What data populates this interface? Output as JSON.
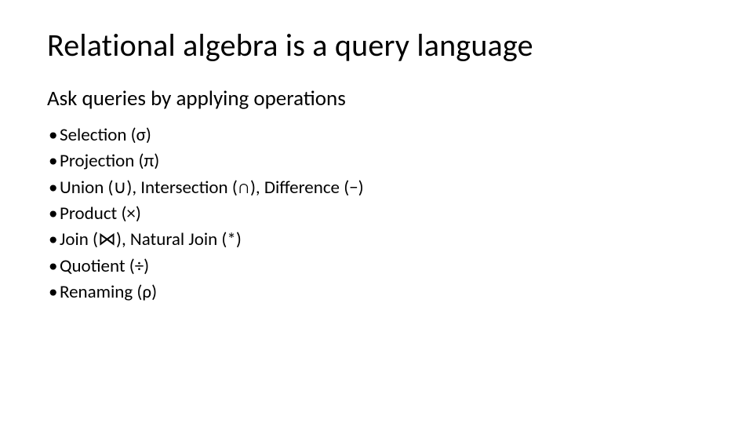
{
  "slide": {
    "title": "Relational algebra is a query language",
    "subheading": "Ask queries by applying operations",
    "bullets": [
      "Selection (σ)",
      "Projection (π)",
      "Union (∪), Intersection (∩), Difference (−)",
      "Product (×)",
      "Join (⋈), Natural Join (*)",
      "Quotient (÷)",
      "Renaming (ρ)"
    ]
  }
}
